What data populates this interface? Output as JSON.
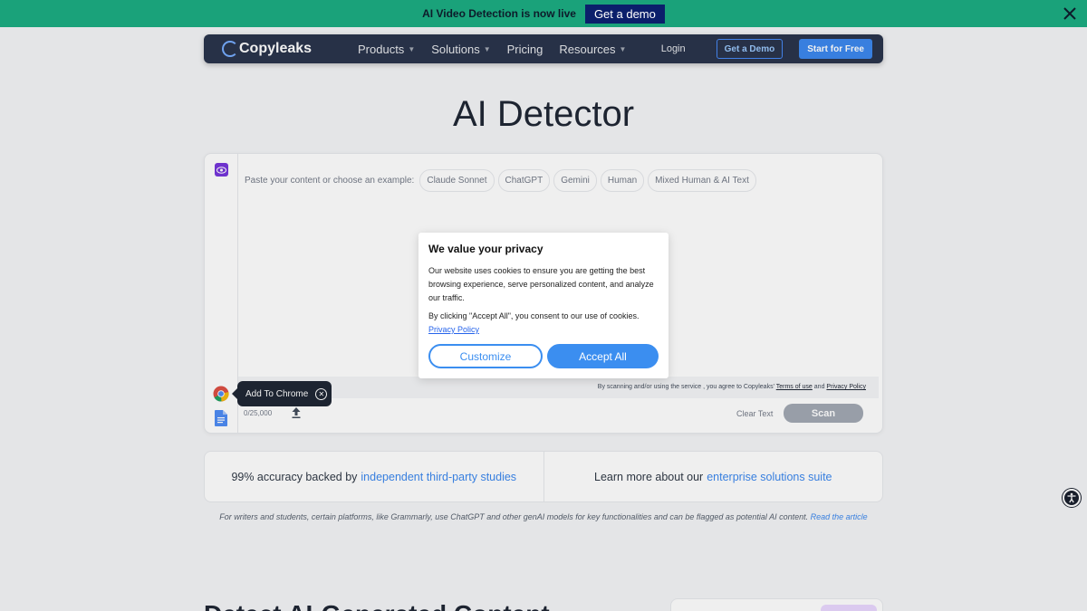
{
  "announcement": {
    "text": "AI Video Detection is now live",
    "button": "Get a demo"
  },
  "nav": {
    "logo": "Copyleaks",
    "links": [
      {
        "label": "Products",
        "dropdown": true
      },
      {
        "label": "Solutions",
        "dropdown": true
      },
      {
        "label": "Pricing",
        "dropdown": false
      },
      {
        "label": "Resources",
        "dropdown": true
      }
    ],
    "login": "Login",
    "demo": "Get a Demo",
    "start": "Start for Free"
  },
  "page_title": "AI Detector",
  "editor": {
    "examples_label": "Paste your content or choose an example:",
    "examples": [
      "Claude Sonnet",
      "ChatGPT",
      "Gemini",
      "Human",
      "Mixed Human & AI Text"
    ],
    "consent_prefix": "By scanning and/or using the service , you agree to Copyleaks'",
    "terms": "Terms of use",
    "and": "and",
    "privacy": "Privacy Policy",
    "count": "0/25,000",
    "clear": "Clear Text",
    "scan": "Scan"
  },
  "tooltip": {
    "text": "Add To Chrome"
  },
  "modal": {
    "title": "We value your privacy",
    "body1": "Our website uses cookies to ensure you are getting the best browsing experience, serve personalized content, and analyze our traffic.",
    "body2": "By clicking \"Accept All\", you consent to our use of cookies.",
    "policy": "Privacy Policy",
    "customize": "Customize",
    "accept": "Accept All"
  },
  "info": {
    "left_text": "99% accuracy backed by",
    "left_link": "independent third-party studies",
    "right_text": "Learn more about our",
    "right_link": "enterprise solutions suite"
  },
  "note": {
    "text": "For writers and students, certain platforms, like Grammarly, use ChatGPT and other genAI models for key functionalities and can be flagged as potential AI content.",
    "link": "Read the article"
  },
  "section_heading": "Detect AI-Generated Content",
  "colors": {
    "announce_bg": "#1aa27a",
    "nav_bg": "#1c2740",
    "accent": "#2f80ed"
  }
}
